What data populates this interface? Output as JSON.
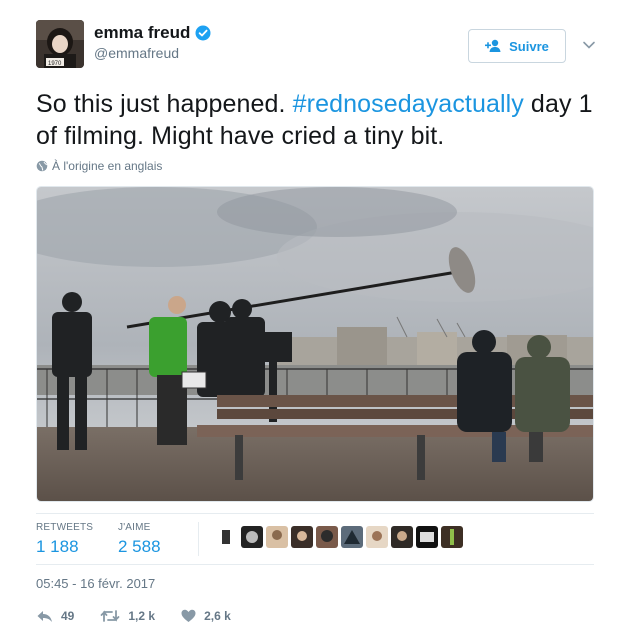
{
  "user": {
    "display_name": "emma freud",
    "handle": "@emmafreud",
    "verified_icon": "verified-badge-icon"
  },
  "follow_button": {
    "label": "Suivre",
    "icon": "add-user-icon"
  },
  "tweet": {
    "text_before": "So this just happened. ",
    "hashtag": "#rednosedayactually",
    "text_after": " day 1 of filming.  Might have cried a tiny bit.",
    "translation_note": "À l'origine en anglais"
  },
  "stats": {
    "retweets_label": "RETWEETS",
    "retweets_value": "1 188",
    "likes_label": "J'AIME",
    "likes_value": "2 588"
  },
  "timestamp": "05:45 - 16 févr. 2017",
  "actions": {
    "reply_count": "49",
    "retweet_count": "1,2 k",
    "like_count": "2,6 k"
  },
  "colors": {
    "accent": "#1b95e0",
    "muted": "#657786",
    "text": "#14171a"
  }
}
